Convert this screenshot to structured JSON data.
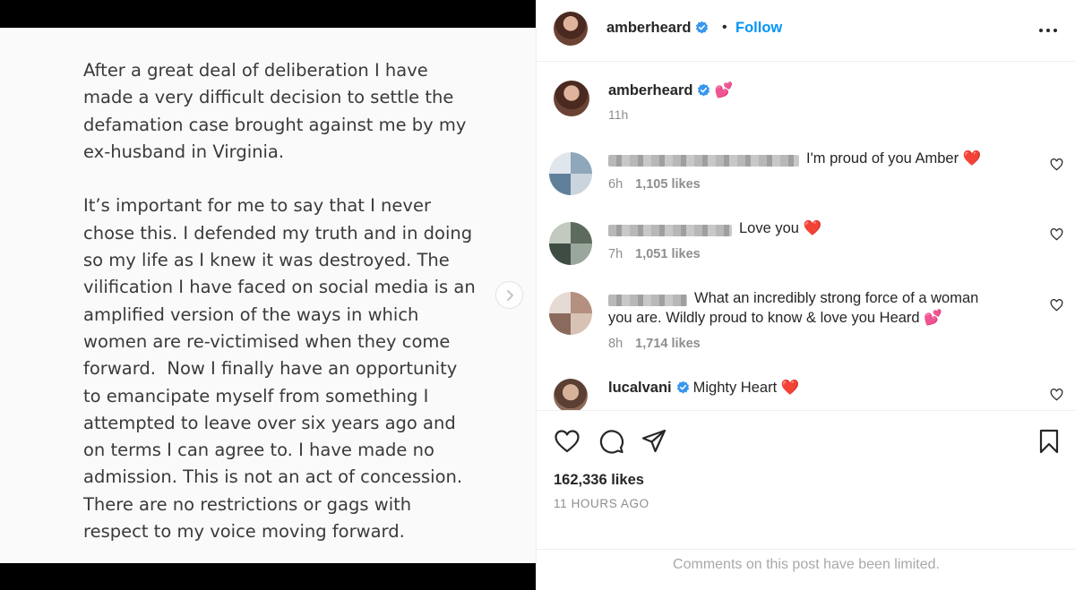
{
  "post_image": {
    "text": "After a great deal of deliberation I have\nmade a very difficult decision to settle the\ndefamation case brought against me by my\nex-husband in Virginia.\n\nIt’s important for me to say that I never\nchose this. I defended my truth and in doing\nso my life as I knew it was destroyed. The\nvilification I have faced on social media is an\namplified version of the ways in which\nwomen are re-victimised when they come\nforward.  Now I finally have an opportunity\nto emancipate myself from something I\nattempted to leave over six years ago and\non terms I can agree to. I have made no\nadmission. This is not an act of concession.\nThere are no restrictions or gags with\nrespect to my voice moving forward.",
    "next_icon": "chevron-right-icon"
  },
  "header": {
    "username": "amberheard",
    "separator": "•",
    "follow_label": "Follow",
    "verified_icon": "verified-badge-icon",
    "more_icon": "more-options-icon",
    "accent_color": "#0095f6"
  },
  "caption": {
    "username": "amberheard",
    "emoji": "💕",
    "time": "11h"
  },
  "comments": [
    {
      "text": "I'm proud of you Amber",
      "emoji": "❤️",
      "time": "6h",
      "likes": "1,105 likes",
      "username_blurred": true
    },
    {
      "text": "Love you",
      "emoji": "❤️",
      "time": "7h",
      "likes": "1,051 likes",
      "username_blurred": true
    },
    {
      "text_line1": "What an incredibly strong force of a woman",
      "text_line2": "you are. Wildly proud to know & love you Heard",
      "emoji": "💕",
      "time": "8h",
      "likes": "1,714 likes",
      "username_blurred": true
    },
    {
      "username": "lucalvani",
      "text": "Mighty Heart",
      "emoji": "❤️",
      "verified": true
    }
  ],
  "actions": {
    "like_icon": "heart-icon",
    "comment_icon": "comment-icon",
    "share_icon": "share-icon",
    "save_icon": "bookmark-icon",
    "likes": "162,336 likes",
    "time_ago": "11 HOURS AGO"
  },
  "footer": {
    "limited_text": "Comments on this post have been limited."
  }
}
